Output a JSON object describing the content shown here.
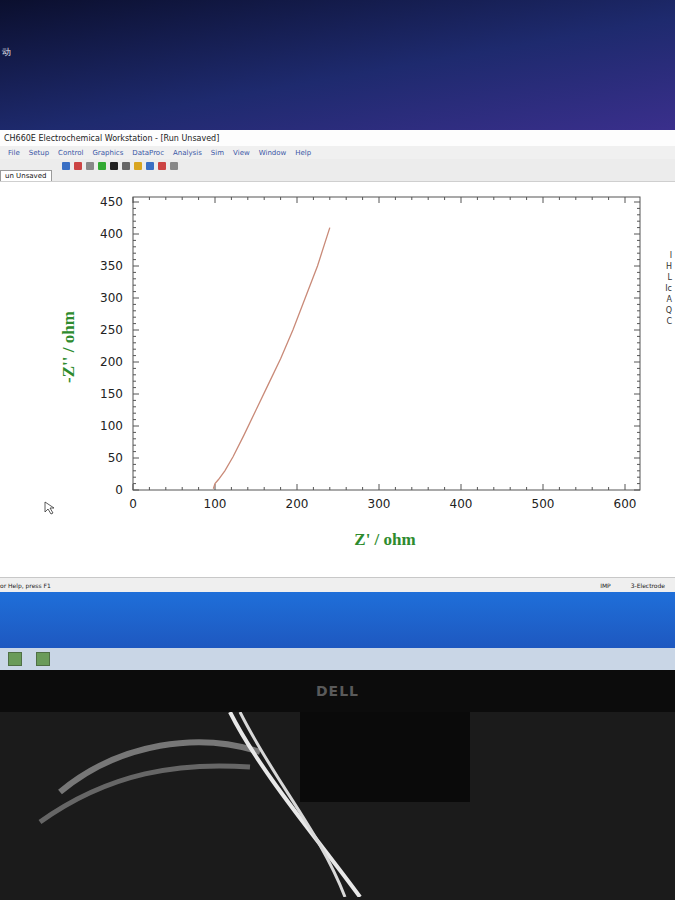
{
  "desktop": {
    "corner_label": "动"
  },
  "window": {
    "title": "CH660E Electrochemical Workstation - [Run Unsaved]"
  },
  "menu": [
    "File",
    "Setup",
    "Control",
    "Graphics",
    "DataProc",
    "Analysis",
    "Sim",
    "View",
    "Window",
    "Help"
  ],
  "tabs": [
    {
      "label": "un Unsaved",
      "selected": true
    }
  ],
  "chart": {
    "x_axis": {
      "title": "Z' / ohm",
      "ticks": [
        "0",
        "100",
        "200",
        "300",
        "400",
        "500",
        "600"
      ]
    },
    "y_axis": {
      "title": "-Z'' / ohm",
      "ticks": [
        "0",
        "50",
        "100",
        "150",
        "200",
        "250",
        "300",
        "350",
        "400",
        "450"
      ]
    },
    "series": [
      {
        "color": "#c98a78",
        "x": [
          98,
          100,
          104,
          112,
          122,
          135,
          150,
          165,
          180,
          195,
          210,
          225,
          240
        ],
        "y": [
          2,
          10,
          16,
          30,
          52,
          85,
          125,
          165,
          205,
          250,
          300,
          350,
          410
        ]
      }
    ]
  },
  "side_panel": {
    "labels": [
      "I",
      "H",
      "L",
      "Ic",
      "A",
      "Q",
      "C"
    ]
  },
  "status_bar": {
    "help": "or Help, press F1",
    "mode": "IMP",
    "electrode": "3-Electrode"
  },
  "monitor": {
    "brand": "DELL"
  }
}
